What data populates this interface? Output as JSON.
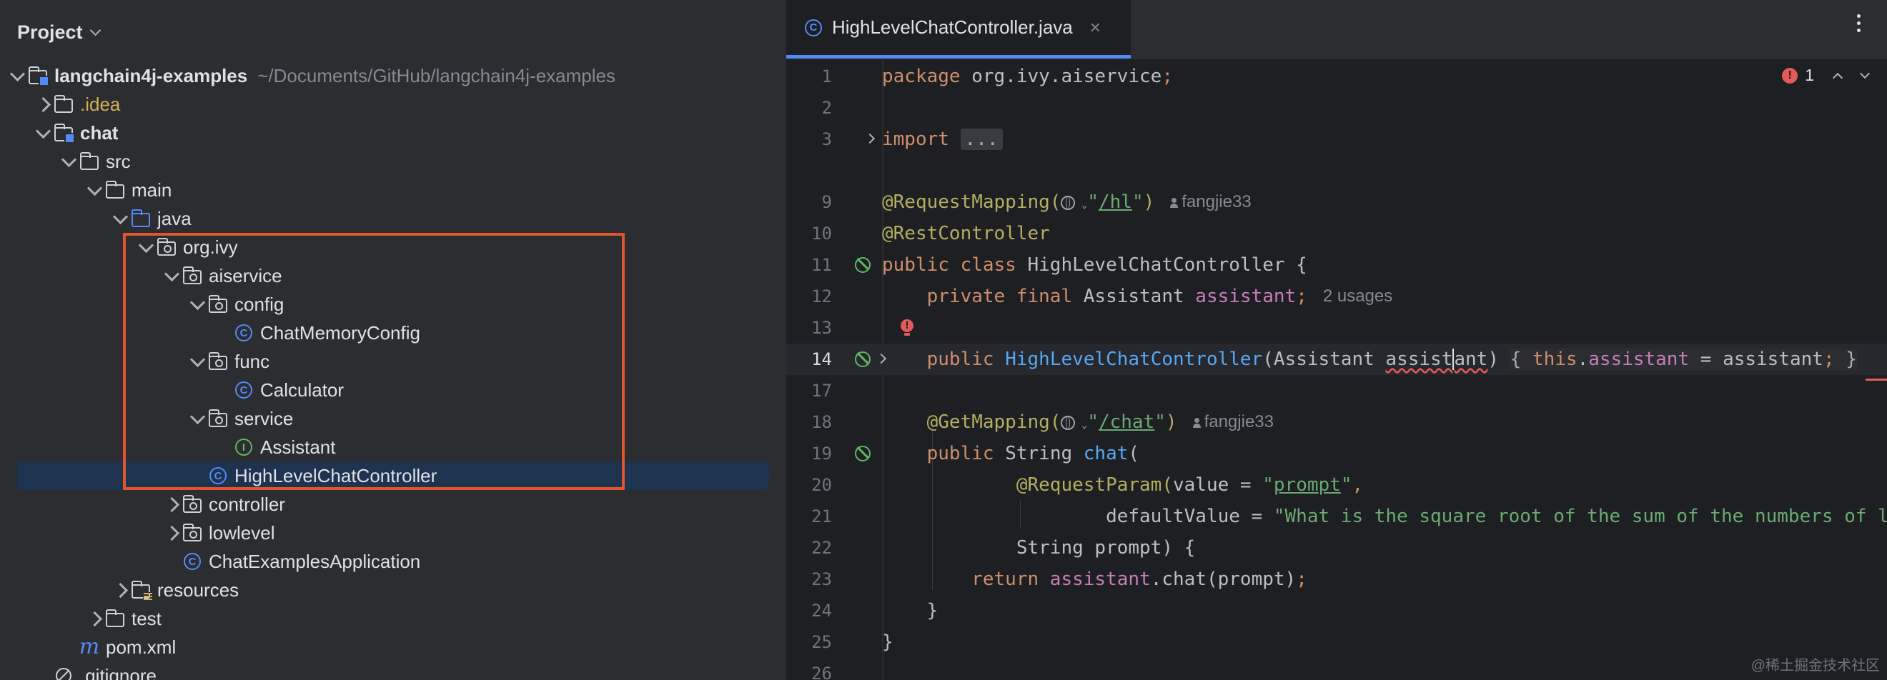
{
  "project_panel": {
    "title": "Project",
    "tree": [
      {
        "label": "langchain4j-examples",
        "path": "~/Documents/GitHub/langchain4j-examples",
        "icon": "module-folder-icon",
        "expanded": true
      },
      {
        "label": ".idea",
        "icon": "folder-icon",
        "expanded": false
      },
      {
        "label": "chat",
        "icon": "module-folder-icon",
        "expanded": true
      },
      {
        "label": "src",
        "icon": "folder-icon",
        "expanded": true
      },
      {
        "label": "main",
        "icon": "folder-icon",
        "expanded": true
      },
      {
        "label": "java",
        "icon": "source-folder-icon",
        "expanded": true
      },
      {
        "label": "org.ivy",
        "icon": "package-icon",
        "expanded": true
      },
      {
        "label": "aiservice",
        "icon": "package-icon",
        "expanded": true
      },
      {
        "label": "config",
        "icon": "package-icon",
        "expanded": true
      },
      {
        "label": "ChatMemoryConfig",
        "icon": "class-icon",
        "badge": "C"
      },
      {
        "label": "func",
        "icon": "package-icon",
        "expanded": true
      },
      {
        "label": "Calculator",
        "icon": "class-icon",
        "badge": "C"
      },
      {
        "label": "service",
        "icon": "package-icon",
        "expanded": true
      },
      {
        "label": "Assistant",
        "icon": "interface-icon",
        "badge": "I"
      },
      {
        "label": "HighLevelChatController",
        "icon": "class-icon",
        "badge": "C",
        "selected": true
      },
      {
        "label": "controller",
        "icon": "package-icon",
        "expanded": false
      },
      {
        "label": "lowlevel",
        "icon": "package-icon",
        "expanded": false
      },
      {
        "label": "ChatExamplesApplication",
        "icon": "spring-boot-class-icon",
        "badge": "C"
      },
      {
        "label": "resources",
        "icon": "resources-folder-icon",
        "expanded": false
      },
      {
        "label": "test",
        "icon": "folder-icon",
        "expanded": false
      },
      {
        "label": "pom.xml",
        "icon": "maven-icon",
        "badge": "m"
      },
      {
        "label": ".gitignore",
        "icon": "ignored-file-icon"
      }
    ]
  },
  "editor": {
    "tab": {
      "label": "HighLevelChatController.java",
      "icon": "class-icon",
      "badge": "C",
      "close": "×"
    },
    "problems": {
      "count": "1",
      "badge": "!"
    },
    "lines": [
      {
        "n": "1",
        "t1": "package",
        "t2": " org.ivy.aiservice",
        "t3": ";"
      },
      {
        "n": "2"
      },
      {
        "n": "3",
        "t1": "import",
        "t2": " ",
        "t3": "..."
      },
      {
        "n": "9",
        "t1": "@RequestMapping(",
        "t2": "\"",
        "t3": "/hl",
        "t4": "\"",
        "t5": ")",
        "author": "fangjie33"
      },
      {
        "n": "10",
        "t1": "@RestController"
      },
      {
        "n": "11",
        "t1": "public class",
        "t2": " HighLevelChatController {"
      },
      {
        "n": "12",
        "t1": "    private final",
        "t2": " Assistant ",
        "t3": "assistant",
        "t4": ";",
        "hint": "2 usages"
      },
      {
        "n": "13"
      },
      {
        "n": "14",
        "t1": "    public",
        "t2": " HighLevelChatController",
        "t3": "(Assistant ",
        "t4": "assist",
        "t5": "ant",
        "t6": ") ",
        "t7": "{ ",
        "t8": "this",
        "t9": ".",
        "t10": "assistant",
        "t11": " = assistant",
        "t12": ";",
        "t13": " }"
      },
      {
        "n": "17"
      },
      {
        "n": "18",
        "t1": "    @GetMapping(",
        "t2": "\"",
        "t3": "/chat",
        "t4": "\"",
        "t5": ")",
        "author": "fangjie33"
      },
      {
        "n": "19",
        "t1": "    public",
        "t2": " String ",
        "t3": "chat",
        "t4": "("
      },
      {
        "n": "20",
        "t1": "            @RequestParam(",
        "t2": "value = ",
        "t3": "\"",
        "t4": "prompt",
        "t5": "\"",
        "t6": ","
      },
      {
        "n": "21",
        "t1": "                    defaultValue = ",
        "t2": "\"What is the square root of the sum of the numbers of l"
      },
      {
        "n": "22",
        "t1": "            String prompt) {"
      },
      {
        "n": "23",
        "t1": "        return",
        "t2": " assistant",
        "t3": ".chat(prompt)",
        "t4": ";"
      },
      {
        "n": "24",
        "t1": "    }"
      },
      {
        "n": "25",
        "t1": "}"
      },
      {
        "n": "26"
      }
    ]
  },
  "watermark": "@稀土掘金技术社区",
  "colors": {
    "accent": "#548af7",
    "highlight_box": "#e0542f",
    "error": "#e55b5b"
  }
}
